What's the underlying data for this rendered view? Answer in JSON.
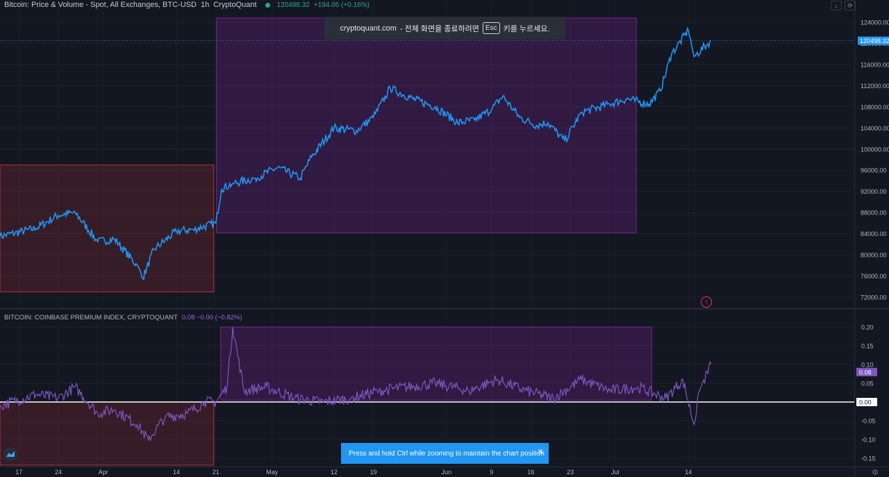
{
  "legend": {
    "title": "Bitcoin: Price & Volume - Spot, All Exchanges, BTC-USD",
    "interval": "1h",
    "source": "CryptoQuant",
    "last": "120498.32",
    "change": "+194.06 (+0.16%)"
  },
  "legend2": {
    "title": "BITCOIN: COINBASE PREMIUM INDEX, CRYPTOQUANT",
    "values": "0.08  −0.00 (−0.82%)"
  },
  "banner": {
    "site": "cryptoquant.com",
    "text_before": "- 전체 화면을 종료하려면",
    "key": "Esc",
    "text_after": "키를 누르세요."
  },
  "toast": {
    "text": "Press and hold Ctrl while zooming to maintain the chart position",
    "close": "✕"
  },
  "warn_icon": "!",
  "colors": {
    "background": "#131722",
    "price_line": "#2196f3",
    "premium_line": "#7e57c2",
    "red_zone": "#f23645",
    "purple_zone": "#9c27b0",
    "zero_line": "#ffffff"
  },
  "chart_data": [
    {
      "type": "line",
      "title": "Bitcoin: Price & Volume - Spot, All Exchanges, BTC-USD",
      "x_labels": [
        "17",
        "24",
        "Apr",
        "14",
        "21",
        "May",
        "12",
        "19",
        "Jun",
        "9",
        "16",
        "23",
        "Jul",
        "14"
      ],
      "y_ticks": [
        "124000.00",
        "120000.00",
        "116000.00",
        "112000.00",
        "108000.00",
        "104000.00",
        "100000.00",
        "96000.00",
        "92000.00",
        "88000.00",
        "84000.00",
        "80000.00",
        "76000.00",
        "72000.00"
      ],
      "ylim": [
        72000,
        128000
      ],
      "last_price_label": "120498.32",
      "series": [
        {
          "x": [
            "Mar 17",
            "Mar 20",
            "Mar 24",
            "Mar 27",
            "Mar 31",
            "Apr 3",
            "Apr 7",
            "Apr 8",
            "Apr 10",
            "Apr 14",
            "Apr 17",
            "Apr 21",
            "Apr 22",
            "Apr 24",
            "Apr 28",
            "May 2",
            "May 6",
            "May 8",
            "May 12",
            "May 16",
            "May 19",
            "May 22",
            "May 26",
            "May 30",
            "Jun 3",
            "Jun 6",
            "Jun 9",
            "Jun 11",
            "Jun 14",
            "Jun 17",
            "Jun 19",
            "Jun 22",
            "Jun 25",
            "Jun 30",
            "Jul 3",
            "Jul 7",
            "Jul 9",
            "Jul 11",
            "Jul 14",
            "Jul 15",
            "Jul 18"
          ],
          "values": [
            83500,
            85000,
            87500,
            88000,
            82500,
            83000,
            78000,
            75500,
            81000,
            84500,
            84800,
            86000,
            92500,
            93500,
            94500,
            96500,
            94500,
            98500,
            104000,
            103500,
            106000,
            111500,
            109500,
            108000,
            105000,
            105500,
            107500,
            110000,
            106000,
            104500,
            105000,
            101500,
            107000,
            108500,
            109500,
            108500,
            111000,
            118000,
            122500,
            117500,
            120498
          ]
        }
      ]
    },
    {
      "type": "line",
      "title": "BITCOIN: COINBASE PREMIUM INDEX, CRYPTOQUANT",
      "y_ticks": [
        "0.20",
        "0.15",
        "0.10",
        "0.05",
        "0.00",
        "-0.05",
        "-0.10",
        "-0.15"
      ],
      "ylim": [
        -0.16,
        0.22
      ],
      "last_value_label": "0.08",
      "zero_label": "0.00",
      "series": [
        {
          "x": [
            "Mar 17",
            "Mar 20",
            "Mar 24",
            "Mar 27",
            "Mar 31",
            "Apr 3",
            "Apr 7",
            "Apr 9",
            "Apr 12",
            "Apr 16",
            "Apr 19",
            "Apr 21",
            "Apr 23",
            "Apr 24",
            "Apr 26",
            "Apr 30",
            "May 5",
            "May 10",
            "May 15",
            "May 20",
            "May 25",
            "May 30",
            "Jun 5",
            "Jun 10",
            "Jun 15",
            "Jun 20",
            "Jun 25",
            "Jun 30",
            "Jul 5",
            "Jul 10",
            "Jul 13",
            "Jul 15",
            "Jul 16",
            "Jul 18"
          ],
          "values": [
            -0.01,
            0.02,
            0.01,
            0.04,
            -0.03,
            -0.02,
            -0.06,
            -0.1,
            -0.04,
            -0.03,
            0.0,
            0.0,
            0.04,
            0.2,
            0.03,
            0.04,
            0.01,
            0.0,
            0.01,
            0.03,
            0.04,
            0.05,
            0.03,
            0.06,
            0.03,
            0.01,
            0.06,
            0.03,
            0.04,
            0.01,
            0.06,
            -0.06,
            0.03,
            0.1
          ]
        }
      ]
    }
  ]
}
